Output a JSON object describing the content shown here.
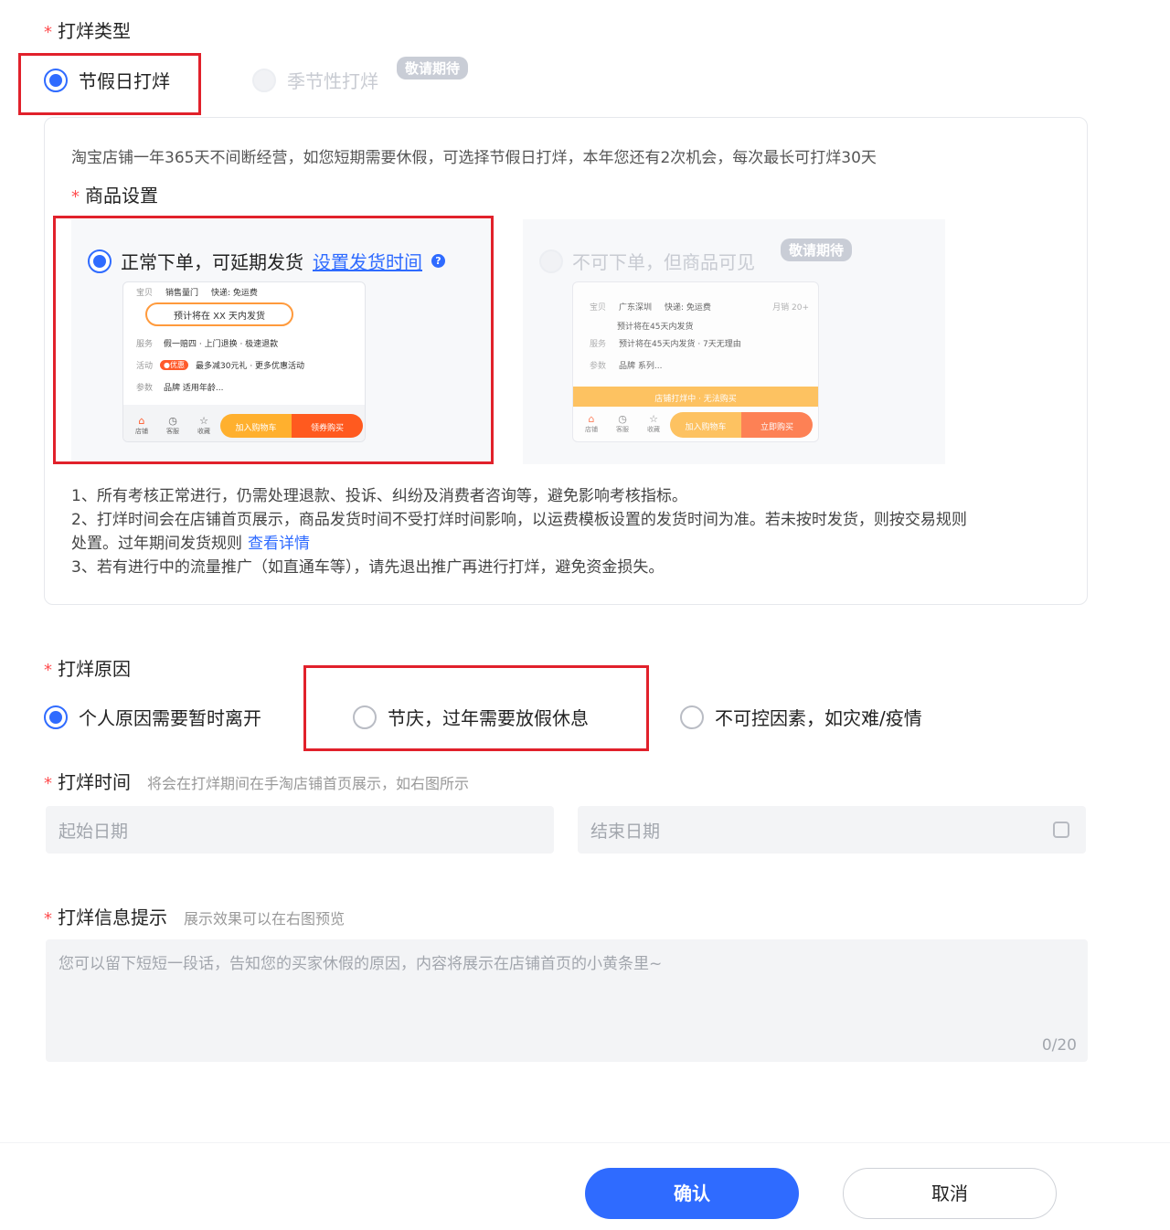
{
  "type_section": {
    "label": "打烊类型",
    "options": [
      {
        "label": "节假日打烊",
        "checked": true
      },
      {
        "label": "季节性打烊",
        "checked": false,
        "badge": "敬请期待"
      }
    ]
  },
  "info_panel": {
    "description": "淘宝店铺一年365天不间断经营，如您短期需要休假，可选择节假日打烊，本年您还有2次机会，每次最长可打烊30天",
    "goods_label": "商品设置",
    "option_a": {
      "label": "正常下单，可延期发货",
      "link": "设置发货时间",
      "preview": {
        "row1_left": "宝贝",
        "row1_a": "销售量门",
        "row1_b": "快递: 免运费",
        "notice": "预计将在 XX 天内发货",
        "row2_left": "服务",
        "row2_text": "假一赔四 · 上门退换 · 极速退款",
        "row3_left": "活动",
        "row3_pill": "●优惠",
        "row3_text": "最多减30元礼 · 更多优惠活动",
        "row4_left": "参数",
        "row4_text": "品牌 适用年龄...",
        "nav": [
          "店铺",
          "客服",
          "收藏"
        ],
        "btn_cart": "加入购物车",
        "btn_buy": "领券购买"
      }
    },
    "option_b": {
      "label": "不可下单，但商品可见",
      "badge": "敬请期待",
      "preview": {
        "row1_left": "宝贝",
        "row1_a": "广东深圳",
        "row1_b": "快递: 免运费",
        "row1_c": "月销 20+",
        "row1_sub": "预计将在45天内发货",
        "row2_left": "服务",
        "row2_text": "预计将在45天内发货 · 7天无理由",
        "row3_left": "参数",
        "row3_text": "品牌 系列...",
        "banner": "店铺打烊中 · 无法购买",
        "nav": [
          "店铺",
          "客服",
          "收藏"
        ],
        "btn_cart": "加入购物车",
        "btn_buy": "立即购买"
      }
    },
    "notes": {
      "n1": "1、所有考核正常进行，仍需处理退款、投诉、纠纷及消费者咨询等，避免影响考核指标。",
      "n2a": "2、打烊时间会在店铺首页展示，商品发货时间不受打烊时间影响，以运费模板设置的发货时间为准。若未按时发货，则按交易规则",
      "n2b": "处置。过年期间发货规则",
      "n2_link": "查看详情",
      "n3": "3、若有进行中的流量推广（如直通车等），请先退出推广再进行打烊，避免资金损失。"
    }
  },
  "reason_section": {
    "label": "打烊原因",
    "options": [
      {
        "label": "个人原因需要暂时离开",
        "checked": true
      },
      {
        "label": "节庆，过年需要放假休息",
        "checked": false
      },
      {
        "label": "不可控因素，如灾难/疫情",
        "checked": false
      }
    ]
  },
  "time_section": {
    "label": "打烊时间",
    "hint": "将会在打烊期间在手淘店铺首页展示，如右图所示",
    "start_placeholder": "起始日期",
    "end_placeholder": "结束日期"
  },
  "message_section": {
    "label": "打烊信息提示",
    "hint": "展示效果可以在右图预览",
    "placeholder": "您可以留下短短一段话，告知您的买家休假的原因，内容将展示在店铺首页的小黄条里~",
    "counter": "0/20"
  },
  "footer": {
    "confirm": "确认",
    "cancel": "取消"
  },
  "colors": {
    "primary": "#2f6bff",
    "highlight": "#e1212b",
    "orange": "#ff6a1a"
  }
}
